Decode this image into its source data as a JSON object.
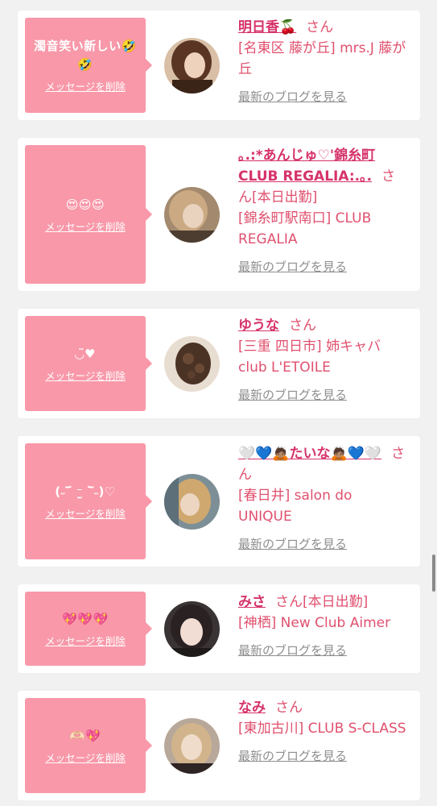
{
  "list": {
    "items": [
      {
        "message": "濁音笑い新しい🤣🤣",
        "delete_label": "メッセージを削除",
        "name": "明日香🍒",
        "honorific": "さん",
        "status": "",
        "shop": "[名東区 藤が丘] mrs.J 藤が丘",
        "blog_link": "最新のブログを見る"
      },
      {
        "message": "😍😍😍",
        "delete_label": "メッセージを削除",
        "name": "｡.:*あんじゅ♡'錦糸町CLUB REGALIA:.｡.",
        "honorific": "さん",
        "status": "[本日出勤]",
        "shop": "[錦糸町駅南口] CLUB REGALIA",
        "blog_link": "最新のブログを見る"
      },
      {
        "message": "◡̈♥",
        "delete_label": "メッセージを削除",
        "name": "ゆうな",
        "honorific": "さん",
        "status": "",
        "shop": "[三重 四日市] 姉キャバclub L'ETOILE",
        "blog_link": "最新のブログを見る"
      },
      {
        "message": "(˶‾᷄ ⁻̫ ‾᷅˵)♡",
        "delete_label": "メッセージを削除",
        "name": "🤍💙🙇🏽たいな🙇🏽💙🤍",
        "honorific": "さん",
        "status": "",
        "shop": "[春日井] salon do UNIQUE",
        "blog_link": "最新のブログを見る"
      },
      {
        "message": "💖💖💖",
        "delete_label": "メッセージを削除",
        "name": "みさ",
        "honorific": "さん",
        "status": "[本日出勤]",
        "shop": "[神栖] New Club Aimer",
        "blog_link": "最新のブログを見る"
      },
      {
        "message": "🫶🏻💖",
        "delete_label": "メッセージを削除",
        "name": "なみ",
        "honorific": "さん",
        "status": "",
        "shop": "[東加古川] CLUB S-CLASS",
        "blog_link": "最新のブログを見る"
      }
    ]
  },
  "colors": {
    "bubble": "#f898a9",
    "name": "#d6336a",
    "text": "#e0506e",
    "link": "#8e8e8e"
  }
}
